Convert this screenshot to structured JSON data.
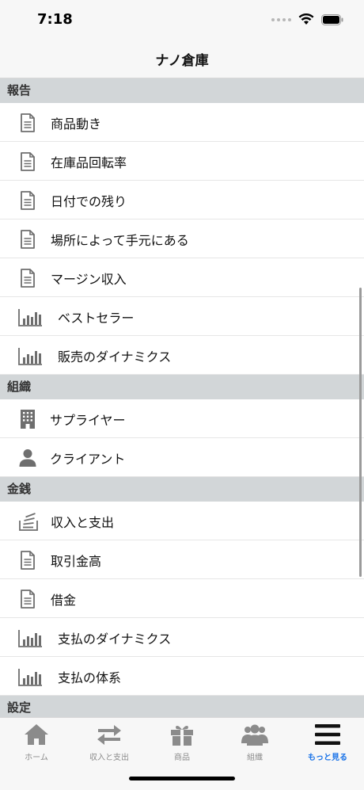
{
  "status": {
    "time": "7:18"
  },
  "nav": {
    "title": "ナノ倉庫"
  },
  "sections": [
    {
      "header": "報告",
      "items": [
        {
          "label": "商品動き",
          "icon": "document-icon"
        },
        {
          "label": "在庫品回転率",
          "icon": "document-icon"
        },
        {
          "label": "日付での残り",
          "icon": "document-icon"
        },
        {
          "label": "場所によって手元にある",
          "icon": "document-icon"
        },
        {
          "label": "マージン収入",
          "icon": "document-icon"
        },
        {
          "label": "ベストセラー",
          "icon": "bar-chart-icon"
        },
        {
          "label": "販売のダイナミクス",
          "icon": "bar-chart-icon"
        }
      ]
    },
    {
      "header": "組織",
      "items": [
        {
          "label": "サプライヤー",
          "icon": "building-icon"
        },
        {
          "label": "クライアント",
          "icon": "person-icon"
        }
      ]
    },
    {
      "header": "金銭",
      "items": [
        {
          "label": "収入と支出",
          "icon": "stack-icon"
        },
        {
          "label": "取引金高",
          "icon": "document-icon"
        },
        {
          "label": "借金",
          "icon": "document-icon"
        },
        {
          "label": "支払のダイナミクス",
          "icon": "bar-chart-icon"
        },
        {
          "label": "支払の体系",
          "icon": "bar-chart-icon"
        }
      ]
    },
    {
      "header": "設定",
      "items": []
    }
  ],
  "tabs": [
    {
      "label": "ホーム",
      "icon": "home-icon",
      "active": false
    },
    {
      "label": "収入と支出",
      "icon": "transfer-arrows-icon",
      "active": false
    },
    {
      "label": "商品",
      "icon": "gift-icon",
      "active": false
    },
    {
      "label": "組織",
      "icon": "people-icon",
      "active": false
    },
    {
      "label": "もっと見る",
      "icon": "menu-icon",
      "active": true
    }
  ],
  "colors": {
    "accent": "#1a73e8",
    "section_bg": "#d2d6d8",
    "icon_gray": "#6e6e6e",
    "tab_inactive": "#8b8b8b"
  }
}
